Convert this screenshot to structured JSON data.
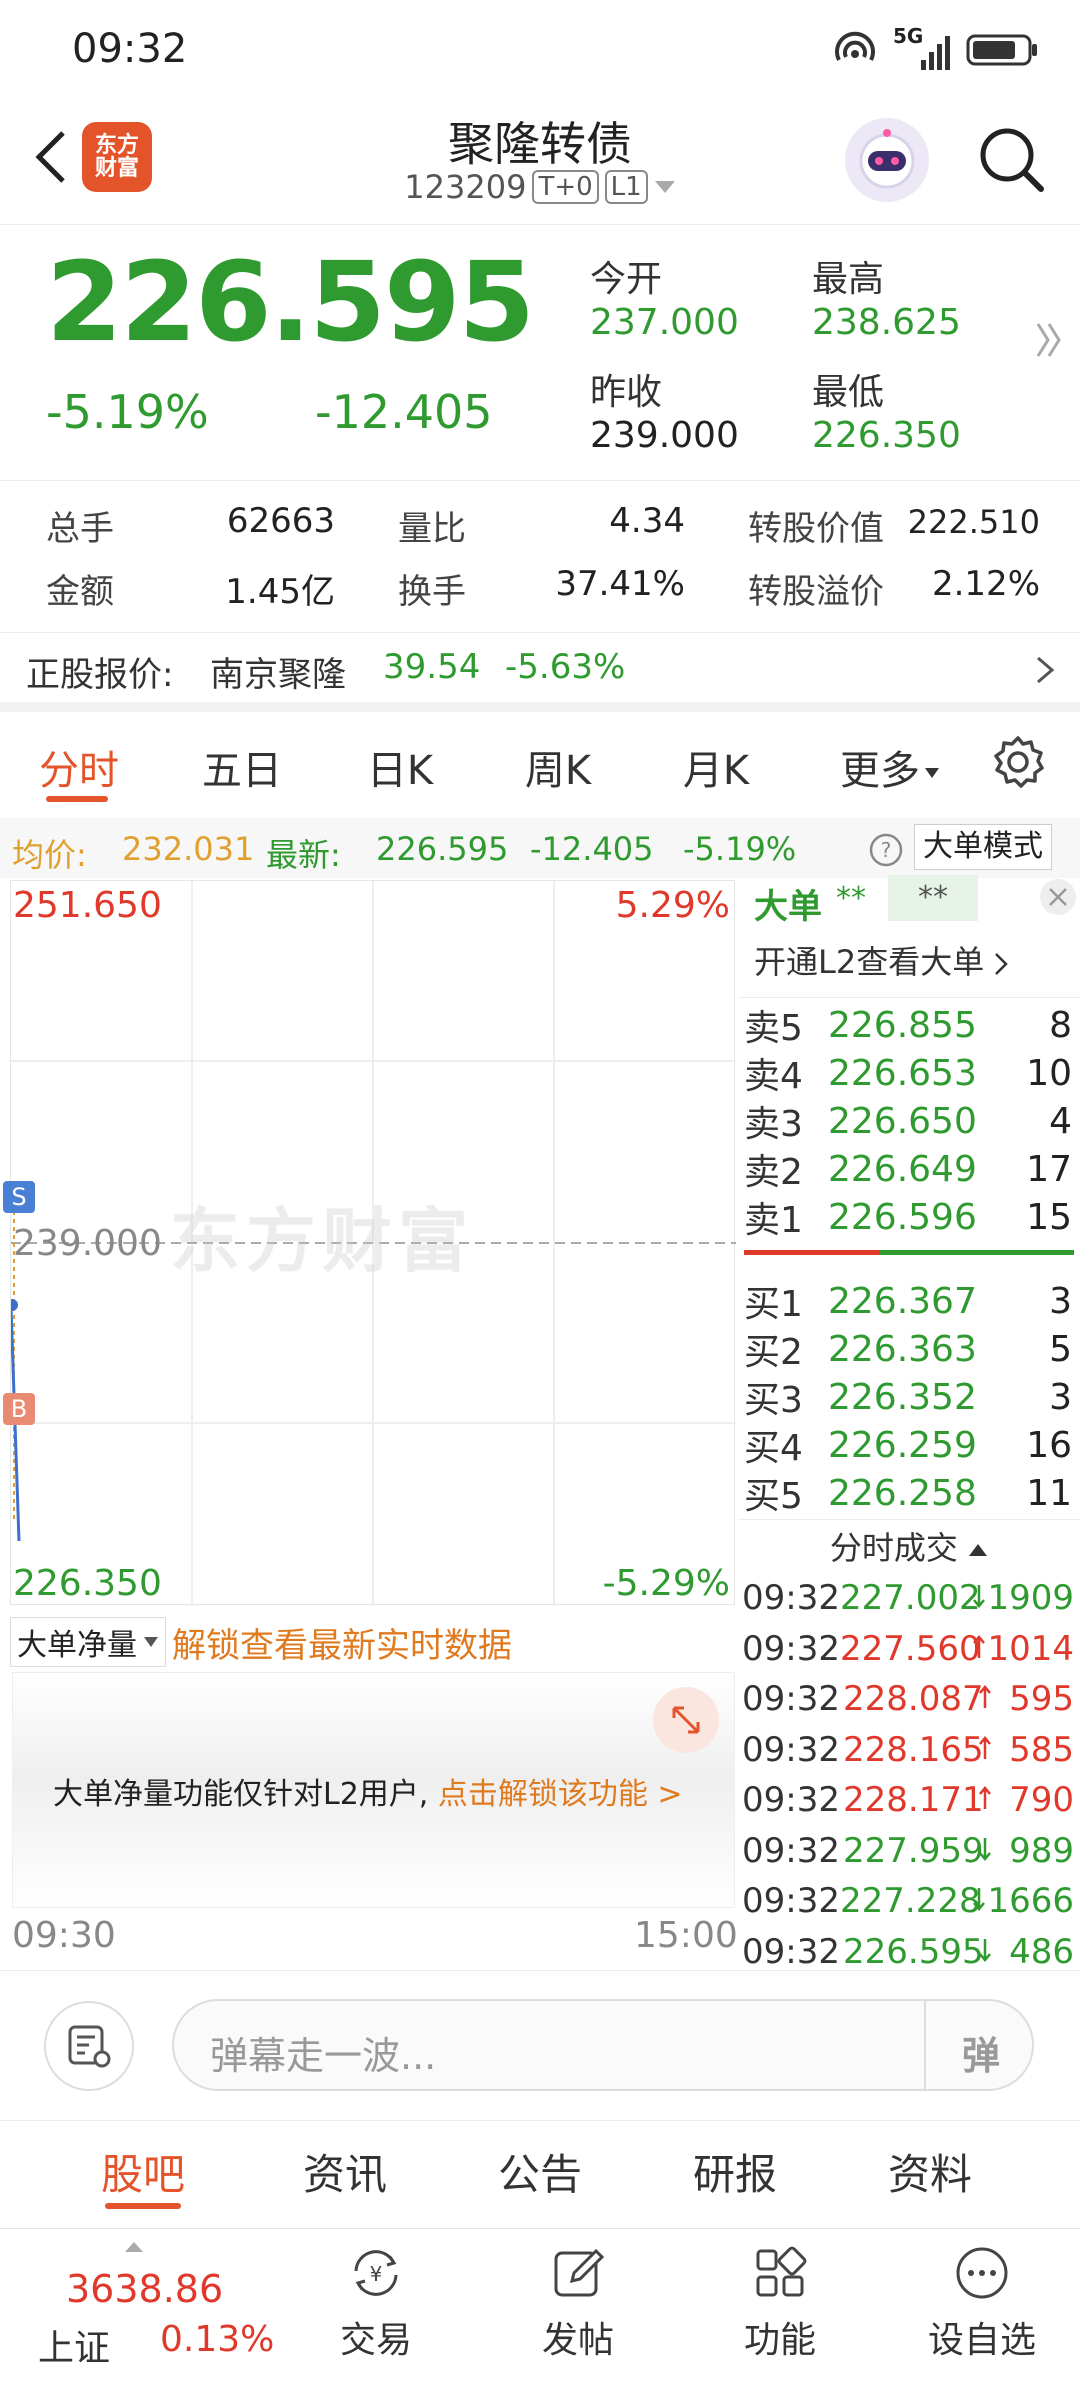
{
  "status_bar": {
    "time": "09:32",
    "network": "5G"
  },
  "header": {
    "logo_line1": "东方",
    "logo_line2": "财富",
    "title": "聚隆转债",
    "code": "123209",
    "tag1": "T+0",
    "tag2": "L1"
  },
  "quote": {
    "price": "226.595",
    "change_pct": "-5.19%",
    "change": "-12.405",
    "open_label": "今开",
    "open": "237.000",
    "high_label": "最高",
    "high": "238.625",
    "prev_close_label": "昨收",
    "prev_close": "239.000",
    "low_label": "最低",
    "low": "226.350"
  },
  "stats": {
    "volume_label": "总手",
    "volume": "62663",
    "ratio_label": "量比",
    "ratio": "4.34",
    "conv_value_label": "转股价值",
    "conv_value": "222.510",
    "amount_label": "金额",
    "amount": "1.45亿",
    "turnover_label": "换手",
    "turnover": "37.41%",
    "premium_label": "转股溢价",
    "premium": "2.12%"
  },
  "underlying": {
    "label": "正股报价:",
    "name": "南京聚隆",
    "price": "39.54",
    "change_pct": "-5.63%"
  },
  "chart_tabs": [
    "分时",
    "五日",
    "日K",
    "周K",
    "月K",
    "更多"
  ],
  "infobar": {
    "avg_label": "均价:",
    "avg": "232.031",
    "latest_label": "最新:",
    "latest": "226.595",
    "change": "-12.405",
    "change_pct": "-5.19%",
    "mode_button": "大单模式"
  },
  "chart": {
    "y_top": "251.650",
    "y_top_pct": "5.29%",
    "y_mid": "239.000",
    "y_bottom": "226.350",
    "y_bottom_pct": "-5.29%",
    "watermark": "东方财富",
    "marker_s": "S",
    "marker_b": "B",
    "time_start": "09:30",
    "time_end": "15:00"
  },
  "big_order": {
    "title": "大单",
    "stars1": "**",
    "stars2": "**",
    "unlock_link": "开通L2查看大单"
  },
  "asks": [
    {
      "label": "卖5",
      "price": "226.855",
      "vol": "8"
    },
    {
      "label": "卖4",
      "price": "226.653",
      "vol": "10"
    },
    {
      "label": "卖3",
      "price": "226.650",
      "vol": "4"
    },
    {
      "label": "卖2",
      "price": "226.649",
      "vol": "17"
    },
    {
      "label": "卖1",
      "price": "226.596",
      "vol": "15"
    }
  ],
  "bids": [
    {
      "label": "买1",
      "price": "226.367",
      "vol": "3"
    },
    {
      "label": "买2",
      "price": "226.363",
      "vol": "5"
    },
    {
      "label": "买3",
      "price": "226.352",
      "vol": "3"
    },
    {
      "label": "买4",
      "price": "226.259",
      "vol": "16"
    },
    {
      "label": "买5",
      "price": "226.258",
      "vol": "11"
    }
  ],
  "trades_title": "分时成交",
  "trades": [
    {
      "time": "09:32",
      "price": "227.002",
      "dir": "down",
      "vol": "1909"
    },
    {
      "time": "09:32",
      "price": "227.560",
      "dir": "up",
      "vol": "1014"
    },
    {
      "time": "09:32",
      "price": "228.087",
      "dir": "up",
      "vol": "595"
    },
    {
      "time": "09:32",
      "price": "228.165",
      "dir": "up",
      "vol": "585"
    },
    {
      "time": "09:32",
      "price": "228.171",
      "dir": "up",
      "vol": "790"
    },
    {
      "time": "09:32",
      "price": "227.959",
      "dir": "down",
      "vol": "989"
    },
    {
      "time": "09:32",
      "price": "227.228",
      "dir": "down",
      "vol": "1666"
    },
    {
      "time": "09:32",
      "price": "226.595",
      "dir": "down",
      "vol": "486"
    }
  ],
  "netvol": {
    "select": "大单净量",
    "unlock": "解锁查看最新实时数据",
    "notice": "大单净量功能仅针对L2用户,",
    "notice_link": "点击解锁该功能 >"
  },
  "danmu": {
    "placeholder": "弹幕走一波...",
    "send": "弹"
  },
  "bottom_tabs": [
    "股吧",
    "资讯",
    "公告",
    "研报",
    "资料"
  ],
  "navbar": {
    "index_value": "3638.86",
    "index_name": "上证",
    "index_pct": "0.13%",
    "items": [
      "交易",
      "发帖",
      "功能",
      "设自选"
    ]
  },
  "colors": {
    "up": "#e0392b",
    "down": "#2f9a2f",
    "accent": "#e3542b",
    "avg_line": "#e0a030"
  }
}
